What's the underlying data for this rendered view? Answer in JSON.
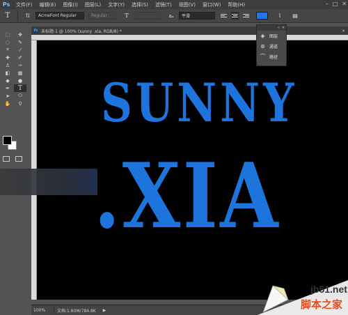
{
  "menubar": {
    "logo": "Ps",
    "items": [
      "文件(F)",
      "编辑(E)",
      "图像(I)",
      "图层(L)",
      "文字(Y)",
      "选择(S)",
      "滤镜(T)",
      "视图(V)",
      "窗口(W)",
      "帮助(H)"
    ]
  },
  "options": {
    "tool_glyph": "T",
    "font_family": "AcmeFont Regular",
    "font_style": "Regular",
    "antialias": "平滑",
    "text_color": "#1f77e8"
  },
  "document": {
    "tab_title": "未标题-1 @ 100% (sunny .xia, RGB/8) *",
    "line1": "SUNNY",
    "line2": ".XIA",
    "text_color": "#1e74dd"
  },
  "status": {
    "zoom": "100%",
    "doc_size": "文档:1.60M/784.8K",
    "arrow": "▶"
  },
  "panel": {
    "items": [
      {
        "label": "图层",
        "icon": "layers-icon"
      },
      {
        "label": "通道",
        "icon": "channels-icon"
      },
      {
        "label": "路径",
        "icon": "paths-icon"
      }
    ]
  },
  "watermark": {
    "site": "jb51.net",
    "name": "脚本之家"
  }
}
